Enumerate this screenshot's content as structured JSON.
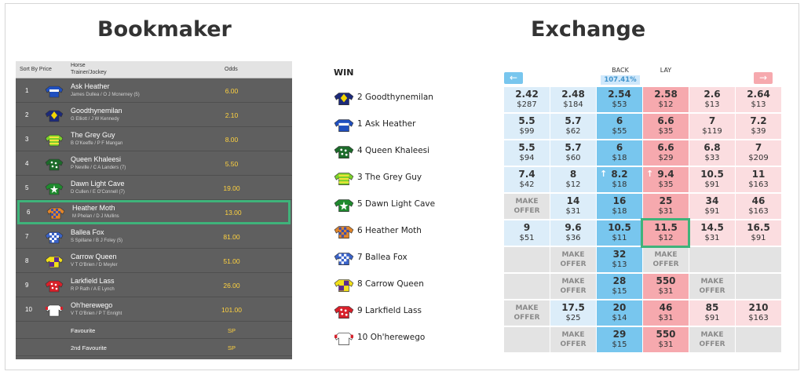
{
  "headings": {
    "bookmaker": "Bookmaker",
    "exchange": "Exchange"
  },
  "bookmaker": {
    "columns": {
      "sort": "Sort By Price",
      "horse": "Horse",
      "trainer_jockey": "Trainer/Jockey",
      "odds": "Odds"
    },
    "rows": [
      {
        "num": "1",
        "horse": "Ask Heather",
        "tj": "James Dullea / O J Mcnerney (5)",
        "odds": "6.00"
      },
      {
        "num": "2",
        "horse": "Goodthynemilan",
        "tj": "G Elliott / J W Kennedy",
        "odds": "2.10"
      },
      {
        "num": "3",
        "horse": "The Grey Guy",
        "tj": "B O'Keeffe / P F Mangan",
        "odds": "8.00"
      },
      {
        "num": "4",
        "horse": "Queen Khaleesi",
        "tj": "P Neville / C A Landers (7)",
        "odds": "5.50"
      },
      {
        "num": "5",
        "horse": "Dawn Light Cave",
        "tj": "D Cullen / E O'Connell (7)",
        "odds": "19.00"
      },
      {
        "num": "6",
        "horse": "Heather Moth",
        "tj": "M Phelan / D J Mullins",
        "odds": "13.00"
      },
      {
        "num": "7",
        "horse": "Ballea Fox",
        "tj": "S Spillane / B J Foley (5)",
        "odds": "81.00"
      },
      {
        "num": "8",
        "horse": "Carrow Queen",
        "tj": "V T O'Brien / D Meyler",
        "odds": "51.00"
      },
      {
        "num": "9",
        "horse": "Larkfield Lass",
        "tj": "R P Rath / A E Lynch",
        "odds": "26.00"
      },
      {
        "num": "10",
        "horse": "Oh'herewego",
        "tj": "V T O'Brien / P T Enright",
        "odds": "101.00"
      }
    ],
    "extras": [
      {
        "label": "Favourite",
        "odds": "SP"
      },
      {
        "label": "2nd Favourite",
        "odds": "SP"
      }
    ]
  },
  "exchange": {
    "win_label": "WIN",
    "back_label": "BACK",
    "lay_label": "LAY",
    "back_percent": "107.41%",
    "runners": [
      "2 Goodthynemilan",
      "1 Ask Heather",
      "4 Queen Khaleesi",
      "3 The Grey Guy",
      "5 Dawn Light Cave",
      "6 Heather Moth",
      "7 Ballea Fox",
      "8 Carrow Queen",
      "9 Larkfield Lass",
      "10 Oh'herewego"
    ],
    "grid": [
      [
        [
          "2.42",
          "$287"
        ],
        [
          "2.48",
          "$184"
        ],
        [
          "2.54",
          "$53"
        ],
        [
          "2.58",
          "$12"
        ],
        [
          "2.6",
          "$13"
        ],
        [
          "2.64",
          "$13"
        ]
      ],
      [
        [
          "5.5",
          "$99"
        ],
        [
          "5.7",
          "$62"
        ],
        [
          "6",
          "$55"
        ],
        [
          "6.6",
          "$35"
        ],
        [
          "7",
          "$119"
        ],
        [
          "7.2",
          "$39"
        ]
      ],
      [
        [
          "5.5",
          "$94"
        ],
        [
          "5.7",
          "$60"
        ],
        [
          "6",
          "$18"
        ],
        [
          "6.6",
          "$29"
        ],
        [
          "6.8",
          "$33"
        ],
        [
          "7",
          "$209"
        ]
      ],
      [
        [
          "7.4",
          "$42"
        ],
        [
          "8",
          "$12"
        ],
        [
          "8.2",
          "$18"
        ],
        [
          "9.4",
          "$35"
        ],
        [
          "10.5",
          "$91"
        ],
        [
          "11",
          "$163"
        ]
      ],
      [
        [
          "MAKE OFFER"
        ],
        [
          "14",
          "$31"
        ],
        [
          "16",
          "$18"
        ],
        [
          "25",
          "$31"
        ],
        [
          "34",
          "$91"
        ],
        [
          "46",
          "$163"
        ]
      ],
      [
        [
          "9",
          "$51"
        ],
        [
          "9.6",
          "$36"
        ],
        [
          "10.5",
          "$11"
        ],
        [
          "11.5",
          "$12"
        ],
        [
          "14.5",
          "$31"
        ],
        [
          "16.5",
          "$91"
        ]
      ],
      [
        [
          ""
        ],
        [
          "MAKE OFFER"
        ],
        [
          "32",
          "$13"
        ],
        [
          "MAKE OFFER"
        ],
        [
          ""
        ],
        [
          ""
        ]
      ],
      [
        [
          ""
        ],
        [
          "MAKE OFFER"
        ],
        [
          "28",
          "$15"
        ],
        [
          "550",
          "$31"
        ],
        [
          "MAKE OFFER"
        ],
        [
          ""
        ]
      ],
      [
        [
          "MAKE OFFER"
        ],
        [
          "17.5",
          "$25"
        ],
        [
          "20",
          "$14"
        ],
        [
          "46",
          "$31"
        ],
        [
          "85",
          "$91"
        ],
        [
          "210",
          "$163"
        ]
      ],
      [
        [
          ""
        ],
        [
          "MAKE OFFER"
        ],
        [
          "29",
          "$15"
        ],
        [
          "550",
          "$31"
        ],
        [
          "MAKE OFFER"
        ],
        [
          ""
        ]
      ]
    ],
    "colors": {
      "back_main": "#78c6ee",
      "back_light": "#dcedf9",
      "lay_main": "#f6a9ae",
      "lay_light": "#fbdde0",
      "selection": "#3fb37a",
      "odds_text": "#ffd23f"
    }
  },
  "silks": [
    {
      "horse": "Ask Heather",
      "icon": "silk-blue-white-hoop"
    },
    {
      "horse": "Goodthynemilan",
      "icon": "silk-navy-yellow-diamond"
    },
    {
      "horse": "The Grey Guy",
      "icon": "silk-green-yellow-stripes"
    },
    {
      "horse": "Queen Khaleesi",
      "icon": "silk-green-white-dots"
    },
    {
      "horse": "Dawn Light Cave",
      "icon": "silk-green-white-star"
    },
    {
      "horse": "Heather Moth",
      "icon": "silk-orange-blue-check"
    },
    {
      "horse": "Ballea Fox",
      "icon": "silk-blue-white-check"
    },
    {
      "horse": "Carrow Queen",
      "icon": "silk-yellow-purple-quartered"
    },
    {
      "horse": "Larkfield Lass",
      "icon": "silk-red-white-dots"
    },
    {
      "horse": "Oh'herewego",
      "icon": "silk-white-red-cap"
    }
  ]
}
